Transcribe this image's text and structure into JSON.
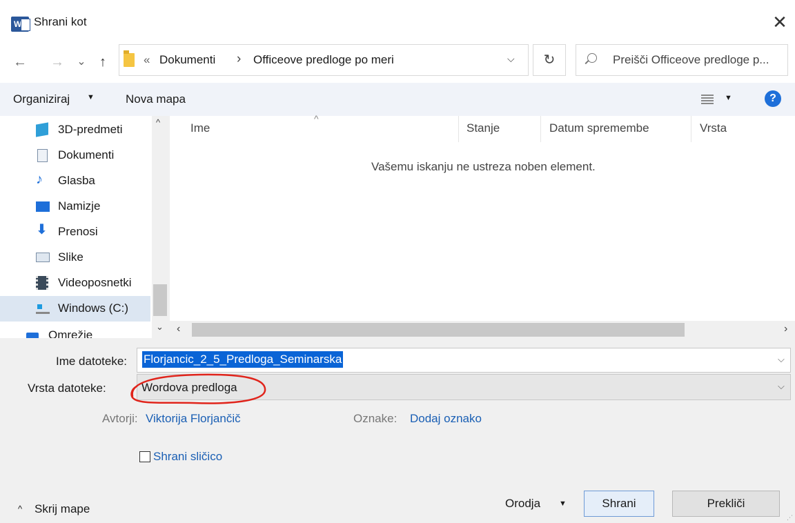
{
  "window": {
    "title": "Shrani kot",
    "app_icon": "word-icon"
  },
  "nav": {
    "back_icon": "←",
    "forward_icon": "→",
    "recent_icon": "⌄",
    "up_icon": "↑",
    "address_overflow": "«",
    "breadcrumbs": [
      "Dokumenti",
      "Officeove predloge po meri"
    ],
    "search_placeholder": "Preišči Officeove predloge p..."
  },
  "toolbar": {
    "organize": "Organiziraj",
    "new_folder": "Nova mapa"
  },
  "sidebar": {
    "items": [
      {
        "label": "3D-predmeti",
        "icon": "cube-icon",
        "color": "#2f9fd8"
      },
      {
        "label": "Dokumenti",
        "icon": "document-icon",
        "color": "#7a8ea6"
      },
      {
        "label": "Glasba",
        "icon": "music-note-icon",
        "color": "#1e6fd9"
      },
      {
        "label": "Namizje",
        "icon": "desktop-icon",
        "color": "#1e6fd9"
      },
      {
        "label": "Prenosi",
        "icon": "download-icon",
        "color": "#1e6fd9"
      },
      {
        "label": "Slike",
        "icon": "pictures-icon",
        "color": "#7a8ea6"
      },
      {
        "label": "Videoposnetki",
        "icon": "film-icon",
        "color": "#3a4a5a"
      },
      {
        "label": "Windows (C:)",
        "icon": "drive-icon",
        "color": "#888888",
        "selected": true
      },
      {
        "label": "Omrežje",
        "icon": "network-icon",
        "color": "#1e6fd9"
      }
    ]
  },
  "file_list": {
    "columns": [
      "Ime",
      "Stanje",
      "Datum spremembe",
      "Vrsta"
    ],
    "empty_message": "Vašemu iskanju ne ustreza noben element."
  },
  "form": {
    "file_name_label": "Ime datoteke:",
    "file_name_value": "Florjancic_2_5_Predloga_Seminarska",
    "file_type_label": "Vrsta datoteke:",
    "file_type_value": "Wordova predloga",
    "authors_label": "Avtorji:",
    "authors_value": "Viktorija Florjančič",
    "tags_label": "Oznake:",
    "tags_value": "Dodaj oznako",
    "save_thumbnail_label": "Shrani sličico",
    "save_thumbnail_checked": false
  },
  "footer": {
    "hide_folders": "Skrij mape",
    "tools": "Orodja",
    "save": "Shrani",
    "cancel": "Prekliči"
  },
  "colors": {
    "link": "#1a5fb4",
    "selection": "#0a64d6",
    "annotation": "#e0241b"
  }
}
